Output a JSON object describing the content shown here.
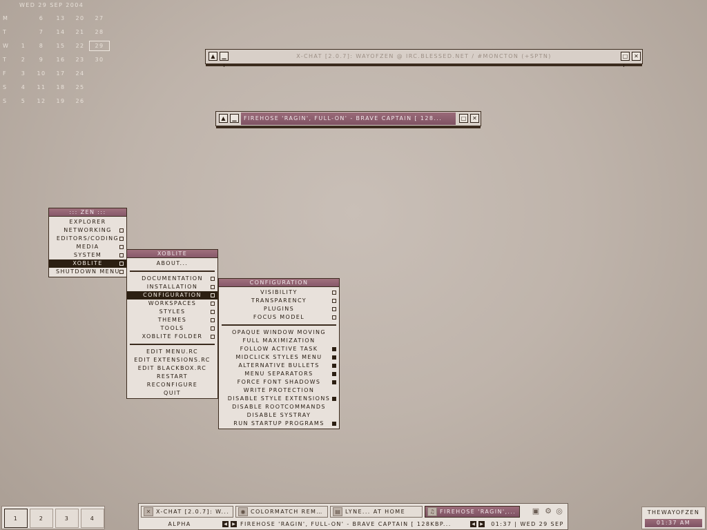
{
  "calendar": {
    "header": "WED 29 SEP 2004",
    "rows": [
      {
        "day": "M",
        "dates": [
          "",
          "6",
          "13",
          "20",
          "27"
        ]
      },
      {
        "day": "T",
        "dates": [
          "",
          "7",
          "14",
          "21",
          "28"
        ]
      },
      {
        "day": "W",
        "dates": [
          "1",
          "8",
          "15",
          "22",
          "29"
        ]
      },
      {
        "day": "T",
        "dates": [
          "2",
          "9",
          "16",
          "23",
          "30"
        ]
      },
      {
        "day": "F",
        "dates": [
          "3",
          "10",
          "17",
          "24",
          ""
        ]
      },
      {
        "day": "S",
        "dates": [
          "4",
          "11",
          "18",
          "25",
          ""
        ]
      },
      {
        "day": "S",
        "dates": [
          "5",
          "12",
          "19",
          "26",
          ""
        ]
      }
    ],
    "today": "29"
  },
  "windows": {
    "xchat": {
      "title": "X-CHAT [2.0.7]: WAYOFZEN @ IRC.BLESSED.NET / #MONCTON (+SPTN)"
    },
    "firehose": {
      "title": "FIREHOSE  'RAGIN', FULL-ON' - BRAVE CAPTAIN  [ 128..."
    }
  },
  "zen_menu": {
    "title": "::: ZEN :::",
    "items": [
      {
        "label": "EXPLORER",
        "submenu": false
      },
      {
        "label": "NETWORKING",
        "submenu": true
      },
      {
        "label": "EDITORS/CODING",
        "submenu": true
      },
      {
        "label": "MEDIA",
        "submenu": true
      },
      {
        "label": "SYSTEM",
        "submenu": true
      },
      {
        "label": "XOBLITE",
        "submenu": true,
        "active": true
      },
      {
        "label": "SHUTDOWN MENU",
        "submenu": true
      }
    ]
  },
  "xoblite_menu": {
    "title": "XOBLITE",
    "about": "ABOUT...",
    "group1": [
      {
        "label": "DOCUMENTATION"
      },
      {
        "label": "INSTALLATION"
      },
      {
        "label": "CONFIGURATION",
        "active": true
      },
      {
        "label": "WORKSPACES"
      },
      {
        "label": "STYLES"
      },
      {
        "label": "THEMES"
      },
      {
        "label": "TOOLS"
      },
      {
        "label": "XOBLITE FOLDER"
      }
    ],
    "group2": [
      "EDIT MENU.RC",
      "EDIT EXTENSIONS.RC",
      "EDIT BLACKBOX.RC",
      "RESTART",
      "RECONFIGURE",
      "QUIT"
    ]
  },
  "config_menu": {
    "title": "CONFIGURATION",
    "submenus": [
      "VISIBILITY",
      "TRANSPARENCY",
      "PLUGINS",
      "FOCUS MODEL"
    ],
    "options": [
      {
        "label": "OPAQUE WINDOW MOVING",
        "checked": false
      },
      {
        "label": "FULL MAXIMIZATION",
        "checked": false
      },
      {
        "label": "FOLLOW ACTIVE TASK",
        "checked": true
      },
      {
        "label": "MIDCLICK STYLES MENU",
        "checked": true
      },
      {
        "label": "ALTERNATIVE BULLETS",
        "checked": true
      },
      {
        "label": "MENU SEPARATORS",
        "checked": true
      },
      {
        "label": "FORCE FONT SHADOWS",
        "checked": true
      },
      {
        "label": "WRITE PROTECTION",
        "checked": false
      },
      {
        "label": "DISABLE STYLE EXTENSIONS",
        "checked": true
      },
      {
        "label": "DISABLE ROOTCOMMANDS",
        "checked": false
      },
      {
        "label": "DISABLE SYSTRAY",
        "checked": false
      },
      {
        "label": "RUN STARTUP PROGRAMS",
        "checked": true
      }
    ]
  },
  "pager": {
    "workspaces": [
      "1",
      "2",
      "3",
      "4"
    ],
    "current": "1"
  },
  "taskbar": {
    "tasks": [
      {
        "label": "X-CHAT [2.0.7]: W...",
        "icon": "xchat-icon"
      },
      {
        "label": "COLORMATCH REMI...",
        "icon": "cd-icon"
      },
      {
        "label": "LYNE... AT HOME",
        "icon": "image-icon"
      },
      {
        "label": "FIREHOSE  'RAGIN',...",
        "icon": "player-icon",
        "active": true
      }
    ],
    "workspace_name": "ALPHA",
    "now_playing": "FIREHOSE  'RAGIN', FULL-ON' - BRAVE CAPTAIN  [ 128KBP...",
    "clock": "01:37 | WED 29 SEP"
  },
  "clock_box": {
    "user": "THEWAYOFZEN",
    "time": "01:37 AM"
  },
  "colors": {
    "accent": "#8a5f6f",
    "dark": "#2c1f12",
    "menu_bg": "#e8e1db"
  }
}
